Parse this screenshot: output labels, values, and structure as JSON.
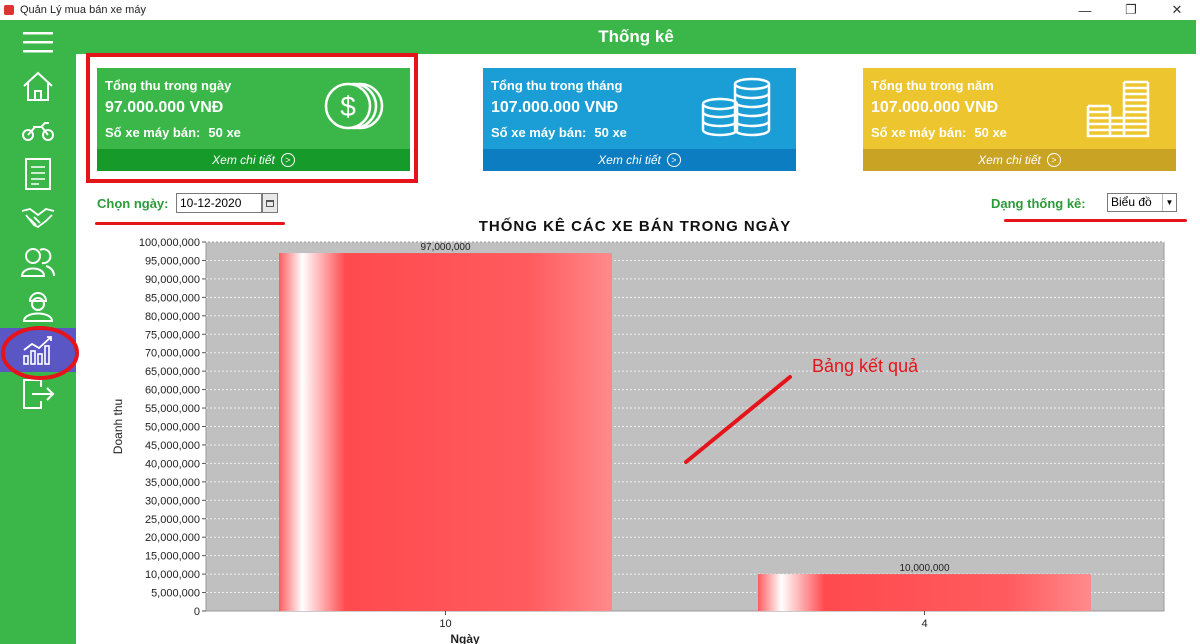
{
  "window": {
    "title": "Quản Lý mua bán xe máy",
    "minimize": "—",
    "maximize": "❐",
    "close": "✕"
  },
  "header": {
    "title": "Thống kê"
  },
  "sidebar": {
    "items": [
      {
        "icon": "hamburger-menu-icon"
      },
      {
        "icon": "home-icon"
      },
      {
        "icon": "motorbike-icon"
      },
      {
        "icon": "invoice-icon"
      },
      {
        "icon": "handshake-icon"
      },
      {
        "icon": "customers-icon"
      },
      {
        "icon": "employee-icon"
      },
      {
        "icon": "statistics-chart-icon",
        "active": true
      },
      {
        "icon": "logout-icon"
      }
    ]
  },
  "cards": {
    "day": {
      "title": "Tổng thu trong ngày",
      "amount": "97.000.000 VNĐ",
      "count_label": "Số xe máy bán:",
      "count": "50 xe",
      "link": "Xem chi tiết"
    },
    "month": {
      "title": "Tổng thu trong tháng",
      "amount": "107.000.000 VNĐ",
      "count_label": "Số xe máy bán:",
      "count": "50 xe",
      "link": "Xem chi tiết"
    },
    "year": {
      "title": "Tổng thu trong năm",
      "amount": "107.000.000 VNĐ",
      "count_label": "Số xe máy bán:",
      "count": "50 xe",
      "link": "Xem chi tiết"
    }
  },
  "filters": {
    "date_label": "Chọn ngày:",
    "date_value": "10-12-2020",
    "type_label": "Dạng thống kê:",
    "type_value": "Biểu đồ"
  },
  "annotation": "Bảng kết quả",
  "colors": {
    "green": "#3bb74a",
    "blue": "#1b9ed6",
    "yellow": "#edc52e",
    "active": "#5a57c4",
    "highlight": "#e5141b",
    "bar": "#ff5b5e",
    "plot_bg": "#c0c0c0"
  },
  "chart_data": {
    "type": "bar",
    "title": "THỐNG KÊ CÁC XE BÁN TRONG NGÀY",
    "xlabel": "Ngày",
    "ylabel": "Doanh thu",
    "categories": [
      "10",
      "4"
    ],
    "values": [
      97000000,
      10000000
    ],
    "value_labels": [
      "97,000,000",
      "10,000,000"
    ],
    "ylim": [
      0,
      100000000
    ],
    "ytick_step": 5000000,
    "grid": true
  }
}
